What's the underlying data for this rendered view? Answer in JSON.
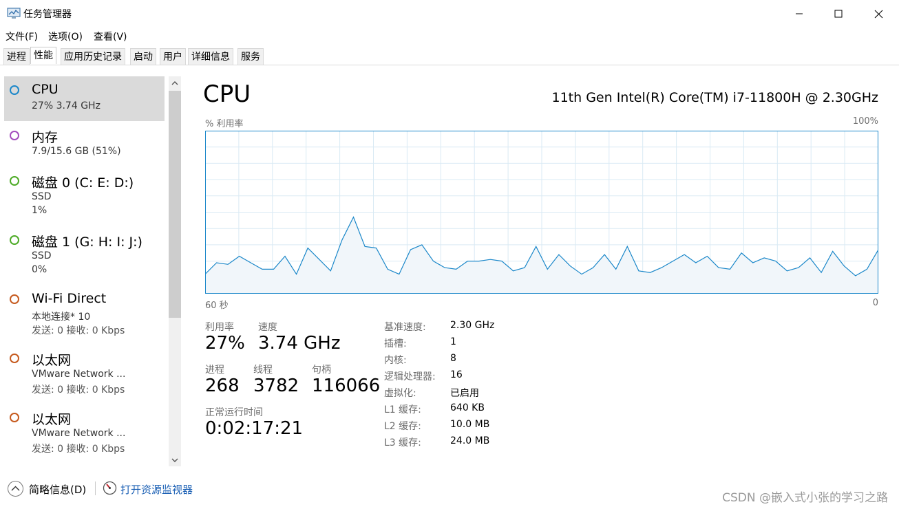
{
  "window": {
    "title": "任务管理器",
    "controls": [
      "minimize-icon",
      "maximize-icon",
      "close-icon"
    ]
  },
  "menu": {
    "file": "文件(F)",
    "options": "选项(O)",
    "view": "查看(V)"
  },
  "tabs": [
    {
      "label": "进程"
    },
    {
      "label": "性能",
      "active": true
    },
    {
      "label": "应用历史记录"
    },
    {
      "label": "启动"
    },
    {
      "label": "用户"
    },
    {
      "label": "详细信息"
    },
    {
      "label": "服务"
    }
  ],
  "sidebar": {
    "items": [
      {
        "title": "CPU",
        "line1": "27%  3.74 GHz",
        "line2": "",
        "color": "#1a87c9",
        "selected": true
      },
      {
        "title": "内存",
        "line1": "7.9/15.6 GB (51%)",
        "line2": "",
        "color": "#a34dbd"
      },
      {
        "title": "磁盘 0 (C: E: D:)",
        "line1": "SSD",
        "line2": "1%",
        "color": "#4caa25"
      },
      {
        "title": "磁盘 1 (G: H: I: J:)",
        "line1": "SSD",
        "line2": "0%",
        "color": "#4caa25"
      },
      {
        "title": "Wi-Fi Direct",
        "line1": "本地连接* 10",
        "line2": "发送: 0  接收: 0 Kbps",
        "color": "#c65a1e"
      },
      {
        "title": "以太网",
        "line1": "VMware Network ...",
        "line2": "发送: 0  接收: 0 Kbps",
        "color": "#c65a1e"
      },
      {
        "title": "以太网",
        "line1": "VMware Network ...",
        "line2": "发送: 0  接收: 0 Kbps",
        "color": "#c65a1e"
      }
    ]
  },
  "main": {
    "title": "CPU",
    "model": "11th Gen Intel(R) Core(TM) i7-11800H @ 2.30GHz",
    "graph_label_left": "% 利用率",
    "graph_label_right": "100%",
    "axis_left": "60 秒",
    "axis_right": "0",
    "stats": {
      "utilization_label": "利用率",
      "utilization": "27%",
      "speed_label": "速度",
      "speed": "3.74 GHz",
      "processes_label": "进程",
      "processes": "268",
      "threads_label": "线程",
      "threads": "3782",
      "handles_label": "句柄",
      "handles": "116066",
      "uptime_label": "正常运行时间",
      "uptime": "0:02:17:21"
    },
    "specs": [
      {
        "label": "基准速度:",
        "value": "2.30 GHz"
      },
      {
        "label": "插槽:",
        "value": "1"
      },
      {
        "label": "内核:",
        "value": "8"
      },
      {
        "label": "逻辑处理器:",
        "value": "16"
      },
      {
        "label": "虚拟化:",
        "value": "已启用"
      },
      {
        "label": "L1 缓存:",
        "value": "640 KB"
      },
      {
        "label": "L2 缓存:",
        "value": "10.0 MB"
      },
      {
        "label": "L3 缓存:",
        "value": "24.0 MB"
      }
    ],
    "colors": {
      "graph_line": "#1a87c9",
      "graph_fill": "#f1f6fa",
      "grid": "#d9eaf4"
    }
  },
  "footer": {
    "fewer_details": "简略信息(D)",
    "open_monitor": "打开资源监视器"
  },
  "watermark": "CSDN @嵌入式小张的学习之路",
  "chart_data": {
    "type": "area",
    "ylim": [
      0,
      100
    ],
    "values": [
      12,
      19,
      18,
      23,
      19,
      15,
      15,
      23,
      12,
      28,
      21,
      14,
      33,
      47,
      29,
      28,
      15,
      12,
      27,
      30,
      20,
      16,
      15,
      20,
      20,
      21,
      20,
      14,
      16,
      29,
      15,
      24,
      17,
      12,
      16,
      24,
      15,
      29,
      14,
      13,
      16,
      20,
      24,
      19,
      23,
      16,
      15,
      25,
      19,
      22,
      20,
      14,
      16,
      22,
      13,
      26,
      17,
      11,
      15,
      27
    ]
  }
}
